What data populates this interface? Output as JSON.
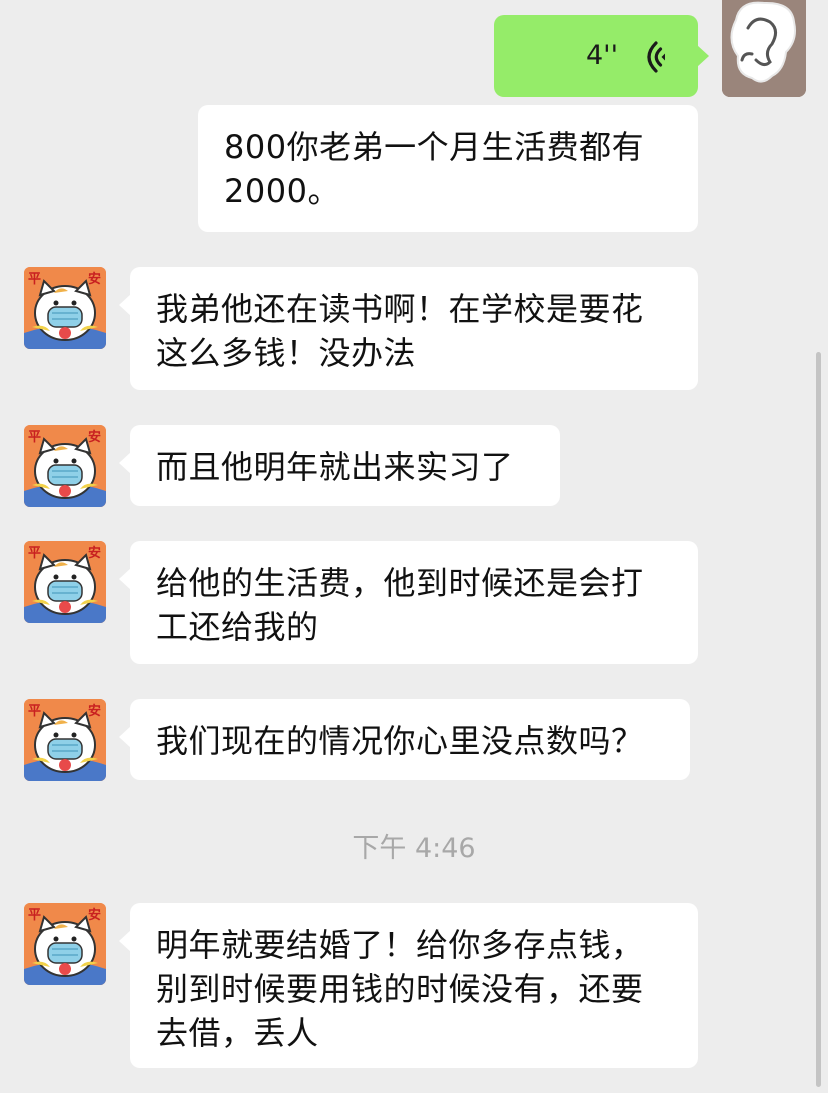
{
  "chat": {
    "voice_message": {
      "duration": "4''"
    },
    "messages": [
      {
        "sender": "self",
        "lines": [
          "800你老弟一个月生活费都有",
          "2000。"
        ]
      },
      {
        "sender": "other",
        "lines": [
          "我弟他还在读书啊！在学校是要花",
          "这么多钱！没办法"
        ]
      },
      {
        "sender": "other",
        "lines": [
          "而且他明年就出来实习了"
        ]
      },
      {
        "sender": "other",
        "lines": [
          "给他的生活费，他到时候还是会打",
          "工还给我的"
        ]
      },
      {
        "sender": "other",
        "lines": [
          "我们现在的情况你心里没点数吗？"
        ]
      },
      {
        "sender": "other",
        "lines": [
          "明年就要结婚了！给你多存点钱，",
          "别到时候要用钱的时候没有，还要",
          "去借，丢人"
        ]
      }
    ],
    "timestamp": "下午 4:46"
  },
  "avatar": {
    "stamp_left": "平",
    "stamp_right": "安"
  },
  "colors": {
    "background": "#ededed",
    "self_bubble": "#95ec69",
    "other_bubble": "#ffffff",
    "timestamp": "#a8a8a8"
  }
}
